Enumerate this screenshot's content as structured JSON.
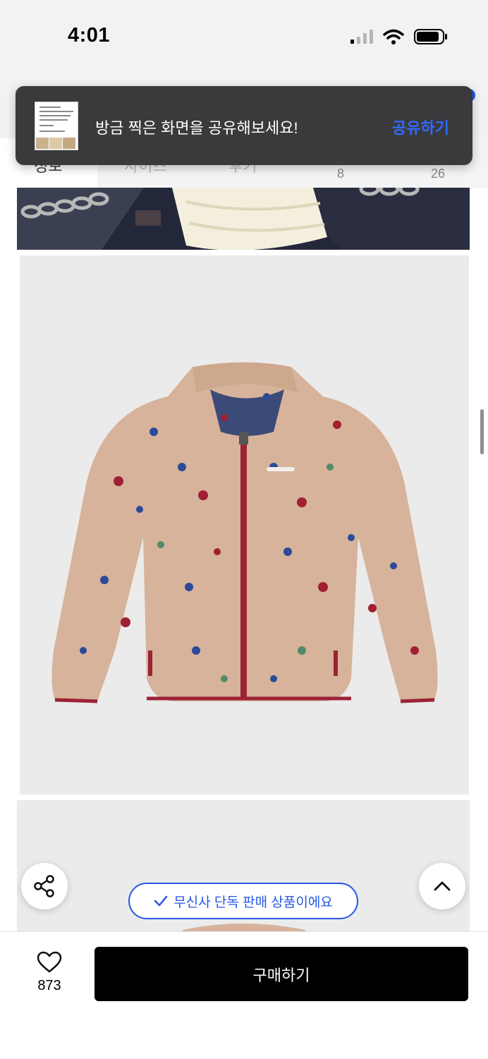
{
  "status_bar": {
    "time": "4:01"
  },
  "toast": {
    "message": "방금 찍은 화면을 공유해보세요!",
    "action_label": "공유하기"
  },
  "tabs": [
    {
      "label": "정보",
      "count": ""
    },
    {
      "label": "사이즈",
      "count": ""
    },
    {
      "label": "후기",
      "count": ""
    },
    {
      "label": "",
      "count": "8"
    },
    {
      "label": "",
      "count": "26"
    }
  ],
  "badge": {
    "exclusive_label": "무신사 단독 판매 상품이에요"
  },
  "footer": {
    "like_count": "873",
    "buy_label": "구매하기"
  },
  "colors": {
    "accent": "#2457e6",
    "buy_button": "#000000",
    "fleece": "#d6b39a"
  },
  "icons": {
    "share": "share-icon",
    "scroll_top": "chevron-up-icon",
    "like": "heart-icon",
    "check": "check-icon"
  }
}
